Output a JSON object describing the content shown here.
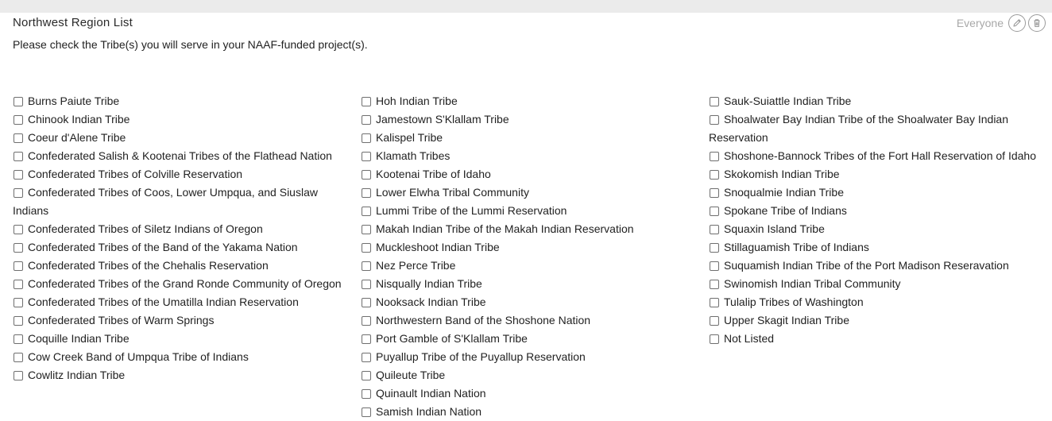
{
  "section": {
    "title": "Northwest Region List",
    "visibility": "Everyone",
    "instructions": "Please check the Tribe(s) you will serve in your NAAF-funded project(s).",
    "edit_icon": "pencil-icon",
    "delete_icon": "trash-icon"
  },
  "columns": [
    [
      "Burns Paiute Tribe",
      "Chinook Indian Tribe",
      "Coeur d'Alene Tribe",
      "Confederated Salish & Kootenai Tribes of the Flathead Nation",
      "Confederated Tribes of Colville Reservation",
      "Confederated Tribes of Coos, Lower Umpqua, and Siuslaw Indians",
      "Confederated Tribes of Siletz Indians of Oregon",
      "Confederated Tribes of the Band of the Yakama Nation",
      "Confederated Tribes of the Chehalis Reservation",
      "Confederated Tribes of the Grand Ronde Community of Oregon",
      "Confederated Tribes of the Umatilla Indian Reservation",
      "Confederated Tribes of Warm Springs",
      "Coquille Indian Tribe",
      "Cow Creek Band of Umpqua Tribe of Indians",
      "Cowlitz Indian Tribe"
    ],
    [
      "Hoh Indian Tribe",
      "Jamestown S'Klallam Tribe",
      "Kalispel Tribe",
      "Klamath Tribes",
      "Kootenai Tribe of Idaho",
      "Lower Elwha Tribal Community",
      "Lummi Tribe of the Lummi Reservation",
      "Makah Indian Tribe of the Makah Indian Reservation",
      "Muckleshoot Indian Tribe",
      "Nez Perce Tribe",
      "Nisqually Indian Tribe",
      "Nooksack Indian Tribe",
      "Northwestern Band of the Shoshone Nation",
      "Port Gamble of S'Klallam Tribe",
      "Puyallup Tribe of the Puyallup Reservation",
      "Quileute Tribe",
      "Quinault Indian Nation",
      "Samish Indian Nation"
    ],
    [
      "Sauk-Suiattle Indian Tribe",
      "Shoalwater Bay Indian Tribe of the Shoalwater Bay Indian Reservation",
      "Shoshone-Bannock Tribes of the Fort Hall Reservation of Idaho",
      "Skokomish Indian Tribe",
      "Snoqualmie Indian Tribe",
      "Spokane Tribe of Indians",
      "Squaxin Island Tribe",
      "Stillaguamish Tribe of Indians",
      "Suquamish Indian Tribe of the Port Madison Reseravation",
      "Swinomish Indian Tribal Community",
      "Tulalip Tribes of Washington",
      "Upper Skagit Indian Tribe",
      "Not Listed"
    ]
  ]
}
